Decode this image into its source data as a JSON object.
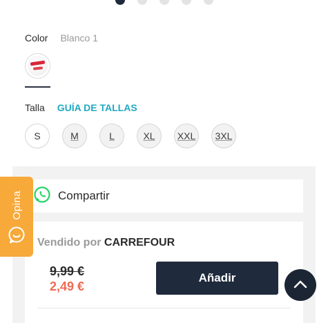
{
  "carousel": {
    "total": 5,
    "active_index": 0
  },
  "color": {
    "label": "Color",
    "value": "Blanco 1",
    "swatch_icon": "tshirt-print-thumbnail"
  },
  "size": {
    "label": "Talla",
    "guide_link": "GUÍA DE TALLAS",
    "options": [
      {
        "label": "S",
        "available": true
      },
      {
        "label": "M",
        "available": false
      },
      {
        "label": "L",
        "available": false
      },
      {
        "label": "XL",
        "available": false
      },
      {
        "label": "XXL",
        "available": false
      },
      {
        "label": "3XL",
        "available": false
      }
    ]
  },
  "share": {
    "label": "Compartir",
    "icon": "whatsapp-icon",
    "icon_color": "#25d366"
  },
  "seller": {
    "prefix": "Vendido por",
    "name": "CARREFOUR",
    "old_price": "9,99 €",
    "new_price": "2,49 €",
    "add_button": "Añadir"
  },
  "feedback_tab": {
    "label": "Opina",
    "icon": "smile-chat-icon",
    "color": "#f7a93a"
  },
  "scroll_top": {
    "icon": "chevron-up-icon"
  },
  "colors": {
    "primary": "#1f2a3c",
    "accent": "#1fa8c2",
    "sale": "#f06a52"
  }
}
